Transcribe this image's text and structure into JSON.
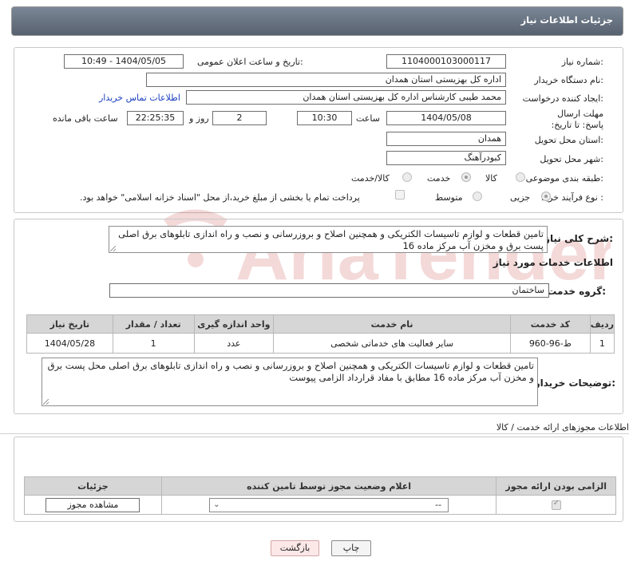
{
  "header": {
    "title": "جزئیات اطلاعات نیاز"
  },
  "form": {
    "need_number": {
      "label": "شماره نیاز:",
      "value": "1104000103000117"
    },
    "announce_datetime": {
      "label": "تاریخ و ساعت اعلان عمومی:",
      "value": "1404/05/05 - 10:49"
    },
    "buyer_org": {
      "label": "نام دستگاه خریدار:",
      "value": "اداره کل بهزیستی استان همدان"
    },
    "requester": {
      "label": "ایجاد کننده درخواست:",
      "value": "محمد طیبی کارشناس اداره کل بهزیستی استان همدان",
      "contact_link": "اطلاعات تماس خریدار"
    },
    "deadline": {
      "label": "مهلت ارسال پاسخ: تا تاریخ:",
      "date": "1404/05/08",
      "time_label": "ساعت",
      "time": "10:30",
      "days": "2",
      "days_label": "روز و",
      "remaining": "22:25:35",
      "remaining_label": "ساعت باقی مانده"
    },
    "province": {
      "label": "استان محل تحویل:",
      "value": "همدان"
    },
    "city": {
      "label": "شهر محل تحویل:",
      "value": "کبودرآهنگ"
    },
    "category": {
      "label": "طبقه بندی موضوعی:",
      "options": [
        "کالا",
        "خدمت",
        "کالا/خدمت"
      ],
      "selected": "خدمت"
    },
    "process": {
      "label": "نوع فرآیند خرید :",
      "options": [
        "جزیی",
        "متوسط"
      ],
      "selected": "جزیی",
      "treasury_note": "پرداخت تمام یا بخشی از مبلغ خرید،از محل \"اسناد خزانه اسلامی\" خواهد بود."
    }
  },
  "summary": {
    "label": "شرح کلی نیاز:",
    "text": "تامین قطعات و لوازم تاسیسات الکتریکی و همچنین اصلاح و بروزرسانی و نصب و راه اندازی تابلوهای برق اصلی پست برق و مخزن آب مرکز ماده 16"
  },
  "services_section": {
    "title": "اطلاعات خدمات مورد نیاز"
  },
  "service_group": {
    "label": "گروه خدمت:",
    "value": "ساختمان"
  },
  "service_table": {
    "headers": [
      "ردیف",
      "کد خدمت",
      "نام خدمت",
      "واحد اندازه گیری",
      "تعداد / مقدار",
      "تاریخ نیاز"
    ],
    "rows": [
      [
        "1",
        "ط-96-960",
        "سایر فعالیت های خدماتی شخصی",
        "عدد",
        "1",
        "1404/05/28"
      ]
    ]
  },
  "buyer_notes": {
    "label": "توضیحات خریدار:",
    "text": "تامین قطعات و لوازم تاسیسات الکتریکی و همچنین اصلاح و بروزرسانی و نصب و راه اندازی تابلوهای برق اصلی محل پست برق و مخزن آب مرکز ماده 16 مطابق با مفاد قرارداد الزامی پیوست"
  },
  "licenses": {
    "section_title": "اطلاعات مجوزهای ارائه خدمت / کالا",
    "headers": [
      "الزامی بودن ارائه مجوز",
      "اعلام وضعیت مجوز توسط تامین کننده",
      "جزئیات"
    ],
    "select_value": "--",
    "view_button": "مشاهده مجوز"
  },
  "actions": {
    "print": "چاپ",
    "back": "بازگشت"
  },
  "watermark": {
    "text": "AriaTender.neT"
  },
  "colors": {
    "header_bg": "#57616f",
    "link": "#1a3fc0",
    "table_header": "#d6d6d6",
    "back_button": "#fde8e8"
  }
}
